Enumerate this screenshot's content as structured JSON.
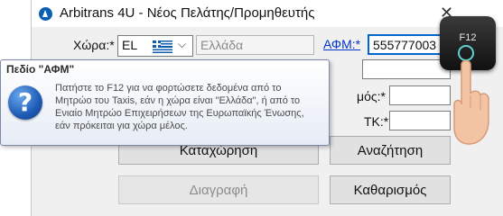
{
  "window": {
    "title": "Arbitrans 4U - Νέος Πελάτης/Προμηθευτής",
    "close": "✕"
  },
  "form": {
    "country_label": "Χώρα:*",
    "country_code": "EL",
    "country_name": "Ελλάδα",
    "afm_label": "ΑΦΜ:*",
    "afm_value": "555777003",
    "partial_label_1": "μός:*",
    "partial_label_2": "ΤΚ:*"
  },
  "buttons": {
    "submit": "Καταχώρηση",
    "search": "Αναζήτηση",
    "delete": "Διαγραφή",
    "clear": "Καθαρισμός"
  },
  "tooltip": {
    "title": "Πεδίο \"ΑΦΜ\"",
    "icon": "?",
    "text": "Πατήστε το F12 για να φορτώσετε δεδομένα από το Μητρώο του Taxis, εάν η χώρα είναι \"Ελλάδα\", ή από το Ενιαίο Μητρώο Επιχειρήσεων της Ευρωπαϊκής Ένωσης, εάν πρόκειται για χώρα μέλος."
  },
  "key_hint": {
    "label": "F12"
  }
}
